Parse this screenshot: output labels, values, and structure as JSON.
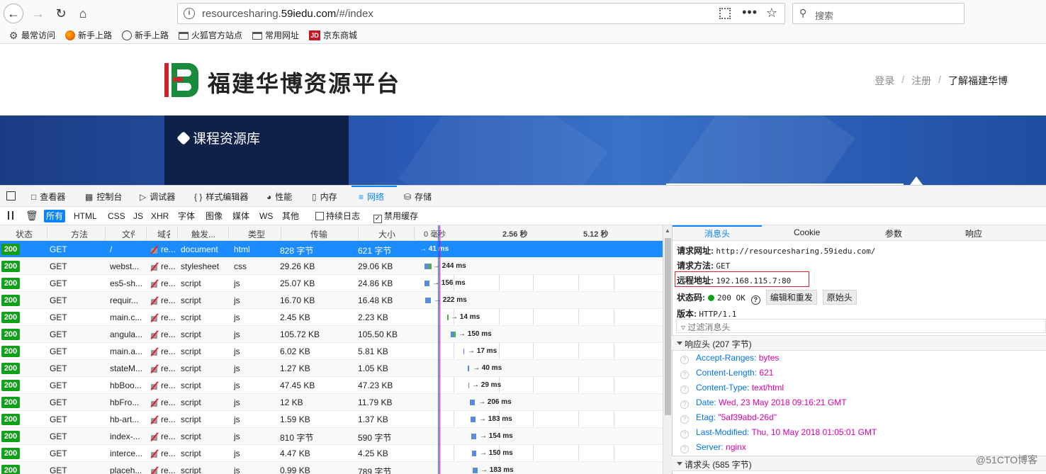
{
  "browser": {
    "url_prefix": "resourcesharing.",
    "url_domain": "59iedu.com",
    "url_path": "/#/index",
    "search_placeholder": "搜索",
    "bookmarks": [
      {
        "label": "最常访问",
        "icon": "gear-icon"
      },
      {
        "label": "新手上路",
        "icon": "firefox-icon"
      },
      {
        "label": "新手上路",
        "icon": "globe-icon"
      },
      {
        "label": "火狐官方站点",
        "icon": "folder-icon"
      },
      {
        "label": "常用网址",
        "icon": "folder-icon"
      },
      {
        "label": "京东商城",
        "icon": "jd-icon"
      }
    ],
    "jd_logo_text": "JD"
  },
  "site": {
    "title": "福建华博资源平台",
    "nav": {
      "login": "登录",
      "sep": "/",
      "register": "注册",
      "about": "了解福建华博"
    },
    "banner_title": "课程资源库"
  },
  "devtools": {
    "tabs": [
      {
        "label": "查看器",
        "icon": "inspector-icon"
      },
      {
        "label": "控制台",
        "icon": "console-icon"
      },
      {
        "label": "调试器",
        "icon": "debugger-icon"
      },
      {
        "label": "样式编辑器",
        "icon": "style-editor-icon"
      },
      {
        "label": "性能",
        "icon": "performance-icon"
      },
      {
        "label": "内存",
        "icon": "memory-icon"
      },
      {
        "label": "网络",
        "icon": "network-icon"
      },
      {
        "label": "存储",
        "icon": "storage-icon"
      }
    ],
    "active_tab": "网络",
    "filters": [
      "所有",
      "HTML",
      "CSS",
      "JS",
      "XHR",
      "字体",
      "图像",
      "媒体",
      "WS",
      "其他"
    ],
    "persist_log": "持续日志",
    "disable_cache": "禁用缓存",
    "columns": [
      "状态",
      "方法",
      "文件",
      "域名",
      "触发...",
      "类型",
      "传输",
      "大小"
    ],
    "timeline_ticks": [
      "0 毫秒",
      "2.56 秒",
      "5.12 秒"
    ],
    "requests": [
      {
        "status": "200",
        "method": "GET",
        "file": "/",
        "domain": "re...",
        "cause": "document",
        "type": "html",
        "transferred": "828 字节",
        "size": "621 字节",
        "time": "→ 41 ms",
        "selected": true
      },
      {
        "status": "200",
        "method": "GET",
        "file": "webst...",
        "domain": "re...",
        "cause": "stylesheet",
        "type": "css",
        "transferred": "29.26 KB",
        "size": "29.06 KB",
        "time": "→ 244 ms"
      },
      {
        "status": "200",
        "method": "GET",
        "file": "es5-sh...",
        "domain": "re...",
        "cause": "script",
        "type": "js",
        "transferred": "25.07 KB",
        "size": "24.86 KB",
        "time": "→ 156 ms"
      },
      {
        "status": "200",
        "method": "GET",
        "file": "requir...",
        "domain": "re...",
        "cause": "script",
        "type": "js",
        "transferred": "16.70 KB",
        "size": "16.48 KB",
        "time": "→ 222 ms"
      },
      {
        "status": "200",
        "method": "GET",
        "file": "main.c...",
        "domain": "re...",
        "cause": "script",
        "type": "js",
        "transferred": "2.45 KB",
        "size": "2.23 KB",
        "time": "→ 14 ms"
      },
      {
        "status": "200",
        "method": "GET",
        "file": "angula...",
        "domain": "re...",
        "cause": "script",
        "type": "js",
        "transferred": "105.72 KB",
        "size": "105.50 KB",
        "time": "→ 150 ms"
      },
      {
        "status": "200",
        "method": "GET",
        "file": "main.a...",
        "domain": "re...",
        "cause": "script",
        "type": "js",
        "transferred": "6.02 KB",
        "size": "5.81 KB",
        "time": "→ 17 ms"
      },
      {
        "status": "200",
        "method": "GET",
        "file": "stateM...",
        "domain": "re...",
        "cause": "script",
        "type": "js",
        "transferred": "1.27 KB",
        "size": "1.05 KB",
        "time": "→ 40 ms"
      },
      {
        "status": "200",
        "method": "GET",
        "file": "hbBoo...",
        "domain": "re...",
        "cause": "script",
        "type": "js",
        "transferred": "47.45 KB",
        "size": "47.23 KB",
        "time": "→ 29 ms"
      },
      {
        "status": "200",
        "method": "GET",
        "file": "hbFro...",
        "domain": "re...",
        "cause": "script",
        "type": "js",
        "transferred": "12 KB",
        "size": "11.79 KB",
        "time": "→ 206 ms"
      },
      {
        "status": "200",
        "method": "GET",
        "file": "hb-art...",
        "domain": "re...",
        "cause": "script",
        "type": "js",
        "transferred": "1.59 KB",
        "size": "1.37 KB",
        "time": "→ 183 ms"
      },
      {
        "status": "200",
        "method": "GET",
        "file": "index-...",
        "domain": "re...",
        "cause": "script",
        "type": "js",
        "transferred": "810 字节",
        "size": "590 字节",
        "time": "→ 154 ms"
      },
      {
        "status": "200",
        "method": "GET",
        "file": "interce...",
        "domain": "re...",
        "cause": "script",
        "type": "js",
        "transferred": "4.47 KB",
        "size": "4.25 KB",
        "time": "→ 150 ms"
      },
      {
        "status": "200",
        "method": "GET",
        "file": "placeh...",
        "domain": "re...",
        "cause": "script",
        "type": "js",
        "transferred": "0.99 KB",
        "size": "789 字节",
        "time": "→ 183 ms"
      }
    ],
    "detail": {
      "tabs": [
        "消息头",
        "Cookie",
        "参数",
        "响应"
      ],
      "request_url_label": "请求网址:",
      "request_url": "http://resourcesharing.59iedu.com/",
      "method_label": "请求方法:",
      "method": "GET",
      "remote_label": "远程地址:",
      "remote": "192.168.115.7:80",
      "status_label": "状态码:",
      "status": "200 OK",
      "edit_resend": "编辑和重发",
      "raw_headers": "原始头",
      "version_label": "版本:",
      "version": "HTTP/1.1",
      "filter_placeholder": "过滤消息头",
      "response_headers_title": "响应头 (207 字节)",
      "response_headers": [
        {
          "k": "Accept-Ranges:",
          "v": "bytes"
        },
        {
          "k": "Content-Length:",
          "v": "621"
        },
        {
          "k": "Content-Type:",
          "v": "text/html"
        },
        {
          "k": "Date:",
          "v": "Wed, 23 May 2018 09:16:21 GMT"
        },
        {
          "k": "Etag:",
          "v": "\"5af39abd-26d\""
        },
        {
          "k": "Last-Modified:",
          "v": "Thu, 10 May 2018 01:05:01 GMT"
        },
        {
          "k": "Server:",
          "v": "nginx"
        }
      ],
      "request_headers_title": "请求头 (585 字节)"
    }
  },
  "watermark": "@51CTO博客",
  "colors": {
    "accent": "#0a84ff",
    "status_ok": "#12a01b",
    "brand_red": "#c8262b",
    "brand_green": "#1a8a3c"
  }
}
